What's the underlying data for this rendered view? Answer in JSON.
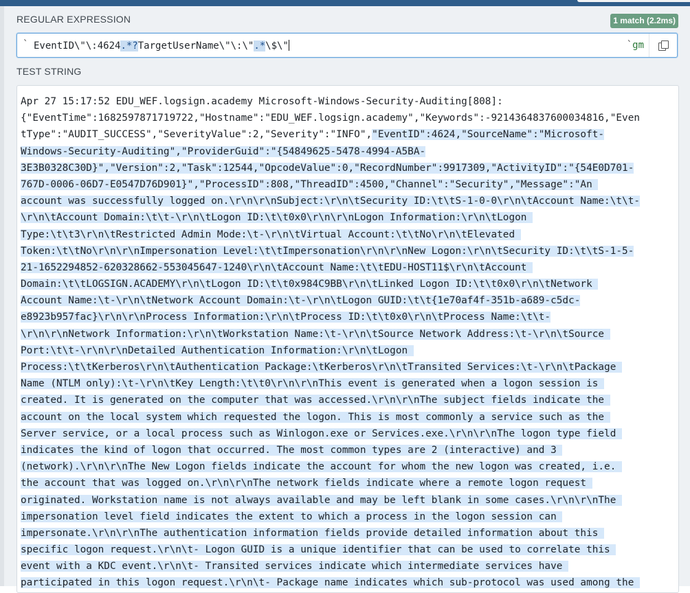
{
  "regex_section": {
    "label": "REGULAR EXPRESSION",
    "match_badge": "1 match (2.2ms)",
    "delimiter_open": "`",
    "pattern_parts": [
      {
        "text": "EventID\\\"\\:4624",
        "hl": false
      },
      {
        "text": ".*?",
        "hl": true
      },
      {
        "text": "TargetUserName\\\"\\:\\\"",
        "hl": false
      },
      {
        "text": ".*",
        "hl": true
      },
      {
        "text": "\\$\\\"",
        "hl": false
      }
    ],
    "delimiter_close": "`",
    "flags": "gm",
    "copy_icon": "copy-icon"
  },
  "test_section": {
    "label": "TEST STRING",
    "lines": [
      {
        "pre": "Apr 27 15:17:52 EDU_WEF.logsign.academy Microsoft-Windows-Security-Auditing[808]: ",
        "match": ""
      },
      {
        "pre": "{\"EventTime\":1682597871719722,\"Hostname\":\"EDU_WEF.logsign.academy\",\"Keywords\":-9214364837600034816,\"Even",
        "match": ""
      },
      {
        "pre": "tType\":\"AUDIT_SUCCESS\",\"SeverityValue\":2,\"Severity\":\"INFO\",",
        "match": "\"EventID\":4624,\"SourceName\":\"Microsoft-"
      },
      {
        "pre": "",
        "match": "Windows-Security-Auditing\",\"ProviderGuid\":\"{54849625-5478-4994-A5BA-"
      },
      {
        "pre": "",
        "match": "3E3B0328C30D}\",\"Version\":2,\"Task\":12544,\"OpcodeValue\":0,\"RecordNumber\":9917309,\"ActivityID\":\"{54E0D701-"
      },
      {
        "pre": "",
        "match": "767D-0006-06D7-E0547D76D901}\",\"ProcessID\":808,\"ThreadID\":4500,\"Channel\":\"Security\",\"Message\":\"An "
      },
      {
        "pre": "",
        "match": "account was successfully logged on.\\r\\n\\r\\nSubject:\\r\\n\\tSecurity ID:\\t\\tS-1-0-0\\r\\n\\tAccount Name:\\t\\t-"
      },
      {
        "pre": "",
        "match": "\\r\\n\\tAccount Domain:\\t\\t-\\r\\n\\tLogon ID:\\t\\t0x0\\r\\n\\r\\nLogon Information:\\r\\n\\tLogon "
      },
      {
        "pre": "",
        "match": "Type:\\t\\t3\\r\\n\\tRestricted Admin Mode:\\t-\\r\\n\\tVirtual Account:\\t\\tNo\\r\\n\\tElevated "
      },
      {
        "pre": "",
        "match": "Token:\\t\\tNo\\r\\n\\r\\nImpersonation Level:\\t\\tImpersonation\\r\\n\\r\\nNew Logon:\\r\\n\\tSecurity ID:\\t\\tS-1-5-"
      },
      {
        "pre": "",
        "match": "21-1652294852-620328662-553045647-1240\\r\\n\\tAccount Name:\\t\\tEDU-HOST11$\\r\\n\\tAccount "
      },
      {
        "pre": "",
        "match": "Domain:\\t\\tLOGSIGN.ACADEMY\\r\\n\\tLogon ID:\\t\\t0x984C9BB\\r\\n\\tLinked Logon ID:\\t\\t0x0\\r\\n\\tNetwork "
      },
      {
        "pre": "",
        "match": "Account Name:\\t-\\r\\n\\tNetwork Account Domain:\\t-\\r\\n\\tLogon GUID:\\t\\t{1e70af4f-351b-a689-c5dc-"
      },
      {
        "pre": "",
        "match": "e8923b957fac}\\r\\n\\r\\nProcess Information:\\r\\n\\tProcess ID:\\t\\t0x0\\r\\n\\tProcess Name:\\t\\t-"
      },
      {
        "pre": "",
        "match": "\\r\\n\\r\\nNetwork Information:\\r\\n\\tWorkstation Name:\\t-\\r\\n\\tSource Network Address:\\t-\\r\\n\\tSource "
      },
      {
        "pre": "",
        "match": "Port:\\t\\t-\\r\\n\\r\\nDetailed Authentication Information:\\r\\n\\tLogon "
      },
      {
        "pre": "",
        "match": "Process:\\t\\tKerberos\\r\\n\\tAuthentication Package:\\tKerberos\\r\\n\\tTransited Services:\\t-\\r\\n\\tPackage "
      },
      {
        "pre": "",
        "match": "Name (NTLM only):\\t-\\r\\n\\tKey Length:\\t\\t0\\r\\n\\r\\nThis event is generated when a logon session is "
      },
      {
        "pre": "",
        "match": "created. It is generated on the computer that was accessed.\\r\\n\\r\\nThe subject fields indicate the "
      },
      {
        "pre": "",
        "match": "account on the local system which requested the logon. This is most commonly a service such as the "
      },
      {
        "pre": "",
        "match": "Server service, or a local process such as Winlogon.exe or Services.exe.\\r\\n\\r\\nThe logon type field "
      },
      {
        "pre": "",
        "match": "indicates the kind of logon that occurred. The most common types are 2 (interactive) and 3 "
      },
      {
        "pre": "",
        "match": "(network).\\r\\n\\r\\nThe New Logon fields indicate the account for whom the new logon was created, i.e. "
      },
      {
        "pre": "",
        "match": "the account that was logged on.\\r\\n\\r\\nThe network fields indicate where a remote logon request "
      },
      {
        "pre": "",
        "match": "originated. Workstation name is not always available and may be left blank in some cases.\\r\\n\\r\\nThe "
      },
      {
        "pre": "",
        "match": "impersonation level field indicates the extent to which a process in the logon session can "
      },
      {
        "pre": "",
        "match": "impersonate.\\r\\n\\r\\nThe authentication information fields provide detailed information about this "
      },
      {
        "pre": "",
        "match": "specific logon request.\\r\\n\\t- Logon GUID is a unique identifier that can be used to correlate this "
      },
      {
        "pre": "",
        "match": "event with a KDC event.\\r\\n\\t- Transited services indicate which intermediate services have "
      },
      {
        "pre": "",
        "match": "participated in this logon request.\\r\\n\\t- Package name indicates which sub-protocol was used among the "
      }
    ]
  }
}
